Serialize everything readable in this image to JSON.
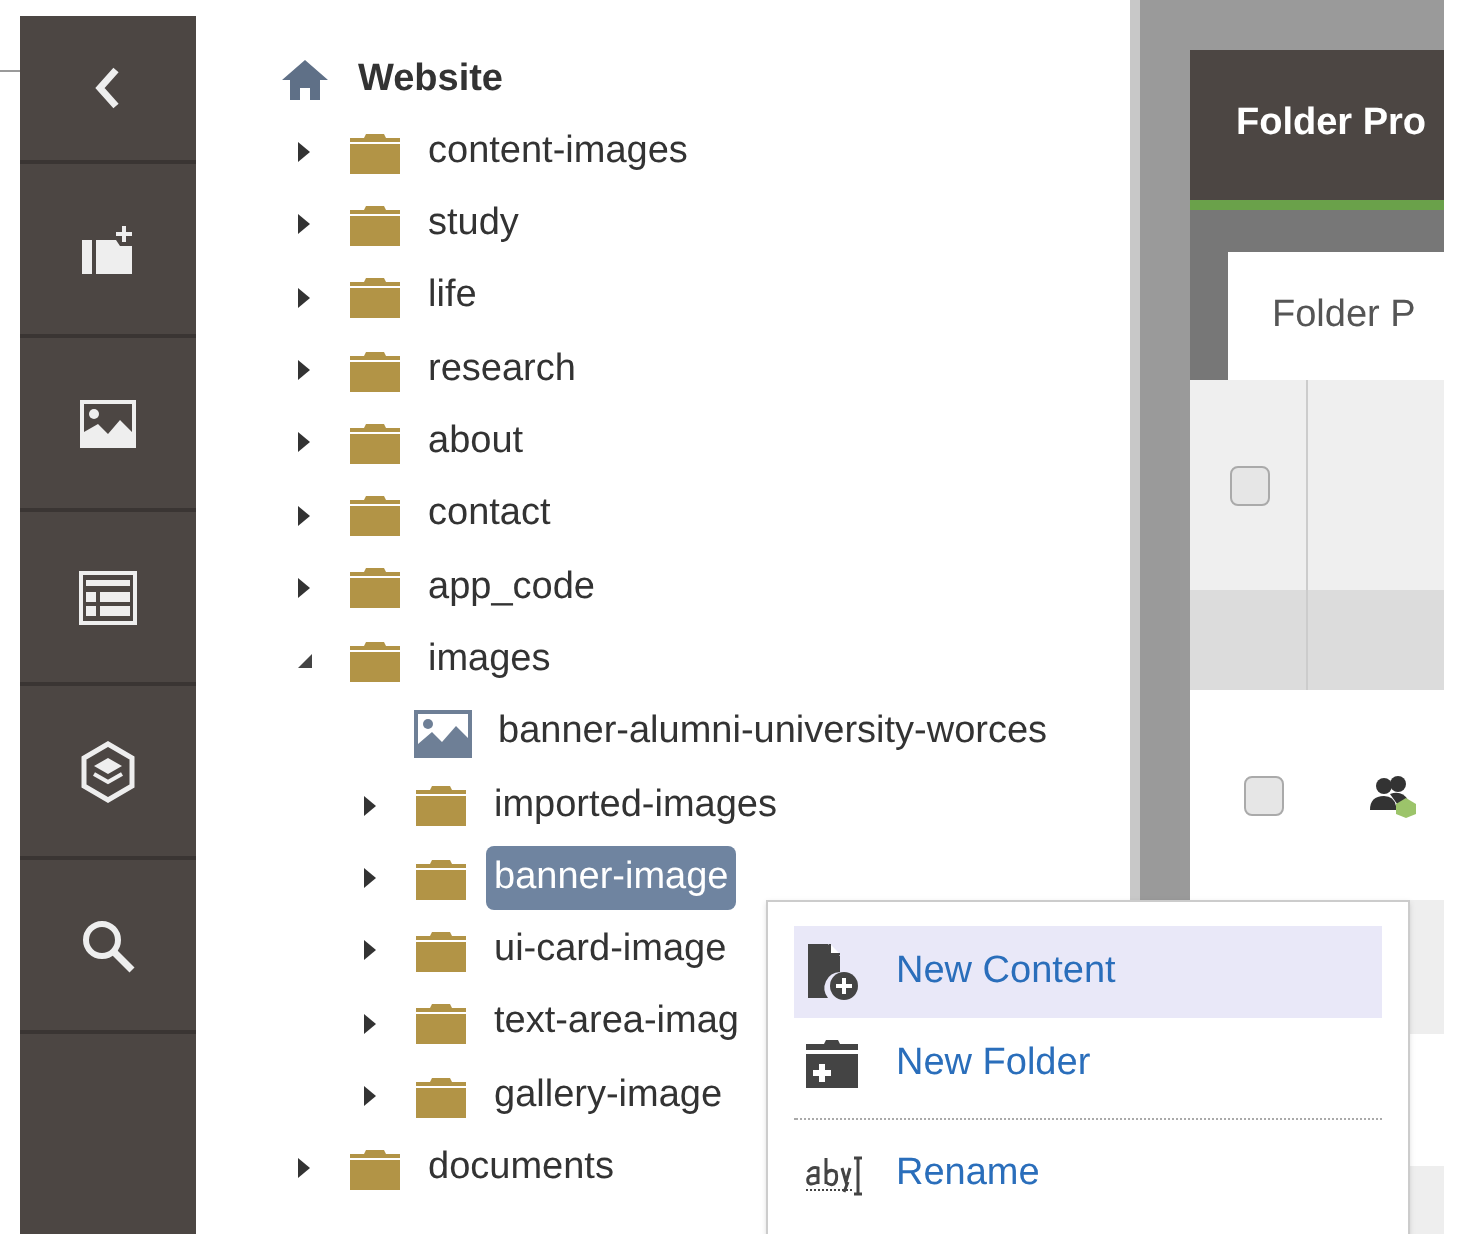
{
  "tree": {
    "root": {
      "label": "Website"
    },
    "children": [
      {
        "label": "content-images",
        "kind": "folder",
        "expanded": false,
        "selected": false
      },
      {
        "label": "study",
        "kind": "folder",
        "expanded": false,
        "selected": false
      },
      {
        "label": "life",
        "kind": "folder",
        "expanded": false,
        "selected": false
      },
      {
        "label": "research",
        "kind": "folder",
        "expanded": false,
        "selected": false
      },
      {
        "label": "about",
        "kind": "folder",
        "expanded": false,
        "selected": false
      },
      {
        "label": "contact",
        "kind": "folder",
        "expanded": false,
        "selected": false
      },
      {
        "label": "app_code",
        "kind": "folder",
        "expanded": false,
        "selected": false
      },
      {
        "label": "images",
        "kind": "folder",
        "expanded": true,
        "selected": false,
        "children": [
          {
            "label": "banner-alumni-university-worces",
            "kind": "image",
            "selected": false
          },
          {
            "label": "imported-images",
            "kind": "folder",
            "expanded": false,
            "selected": false
          },
          {
            "label": "banner-image",
            "kind": "folder",
            "expanded": false,
            "selected": true
          },
          {
            "label": "ui-card-image",
            "kind": "folder",
            "expanded": false,
            "selected": false
          },
          {
            "label": "text-area-imag",
            "kind": "folder",
            "expanded": false,
            "selected": false
          },
          {
            "label": "gallery-image",
            "kind": "folder",
            "expanded": false,
            "selected": false
          }
        ]
      },
      {
        "label": "documents",
        "kind": "folder",
        "expanded": false,
        "selected": false
      }
    ]
  },
  "panel": {
    "title": "Folder Pro",
    "tab": "Folder P",
    "header_checkbox": {
      "checked": false
    },
    "rows": [
      {
        "checked": false
      }
    ]
  },
  "context_menu": {
    "groups": [
      [
        {
          "label": "New Content",
          "kind": "new-content",
          "selected": true
        },
        {
          "label": "New Folder",
          "kind": "new-folder",
          "selected": false
        }
      ],
      [
        {
          "label": "Rename",
          "kind": "rename",
          "selected": false
        }
      ]
    ]
  }
}
